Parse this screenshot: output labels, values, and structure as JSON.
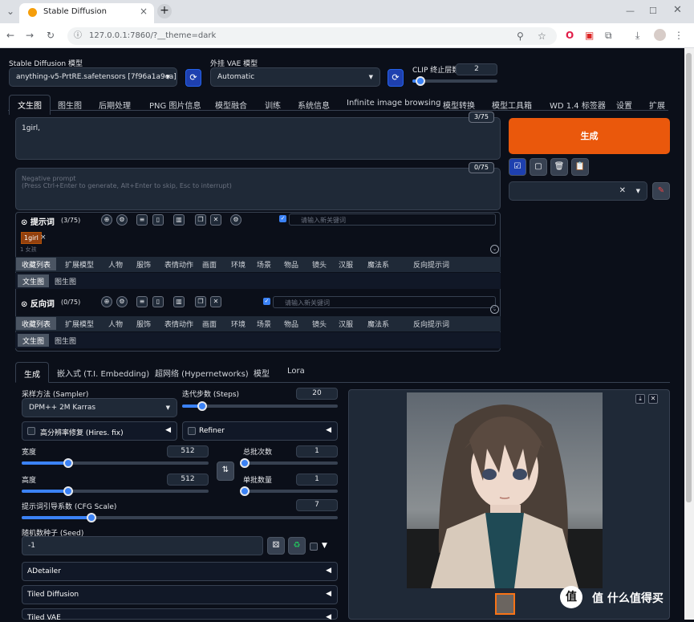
{
  "browser": {
    "tab_title": "Stable Diffusion",
    "url": "127.0.0.1:7860/?__theme=dark"
  },
  "top": {
    "model_label": "Stable Diffusion 模型",
    "model_value": "anything-v5-PrtRE.safetensors [7f96a1a9ca]",
    "vae_label": "外挂 VAE 模型",
    "vae_value": "Automatic",
    "clip_label": "CLIP 终止层数",
    "clip_value": "2",
    "clip_fraction": 0.09
  },
  "main_tabs": [
    "文生图",
    "图生图",
    "后期处理",
    "PNG 图片信息",
    "模型融合",
    "训练",
    "系统信息",
    "Infinite image browsing",
    "模型转换",
    "模型工具箱",
    "WD 1.4 标签器",
    "设置",
    "扩展"
  ],
  "prompt": {
    "text": "1girl,",
    "counter": "3/75",
    "neg_placeholder": "Negative prompt\n(Press Ctrl+Enter to generate, Alt+Enter to skip, Esc to interrupt)",
    "neg_counter": "0/75"
  },
  "generate_label": "生成",
  "helper": {
    "pos_title": "提示词",
    "pos_count": "(3/75)",
    "neg_title": "反向词",
    "neg_count": "(0/75)",
    "keyword_placeholder": "请输入新关键词",
    "tag": "1girl",
    "tag_sub": "1 女孩",
    "categories": [
      "收藏列表",
      "扩展模型",
      "人物",
      "服饰",
      "表情动作",
      "画面",
      "环境",
      "场景",
      "物品",
      "镜头",
      "汉服",
      "魔法系",
      "反向提示词"
    ],
    "subtabs": [
      "文生图",
      "图生图"
    ]
  },
  "sub_tabs": [
    "生成",
    "嵌入式 (T.I. Embedding)",
    "超网络 (Hypernetworks)",
    "模型",
    "Lora"
  ],
  "params": {
    "sampler_label": "采样方法 (Sampler)",
    "sampler_value": "DPM++ 2M Karras",
    "steps_label": "迭代步数 (Steps)",
    "steps_value": "20",
    "steps_fraction": 0.13,
    "hires_label": "高分辨率修复 (Hires. fix)",
    "refiner_label": "Refiner",
    "width_label": "宽度",
    "width_value": "512",
    "width_fraction": 0.25,
    "height_label": "高度",
    "height_value": "512",
    "height_fraction": 0.25,
    "batch_count_label": "总批次数",
    "batch_count_value": "1",
    "batch_size_label": "单批数量",
    "batch_size_value": "1",
    "cfg_label": "提示词引导系数 (CFG Scale)",
    "cfg_value": "7",
    "cfg_fraction": 0.22,
    "seed_label": "随机数种子 (Seed)",
    "seed_value": "-1"
  },
  "accordions": [
    "ADetailer",
    "Tiled Diffusion",
    "Tiled VAE"
  ],
  "watermark": "值 什么值得买",
  "colors": {
    "accent": "#f97316",
    "primary": "#3b82f6",
    "bg": "#0b0f19"
  }
}
